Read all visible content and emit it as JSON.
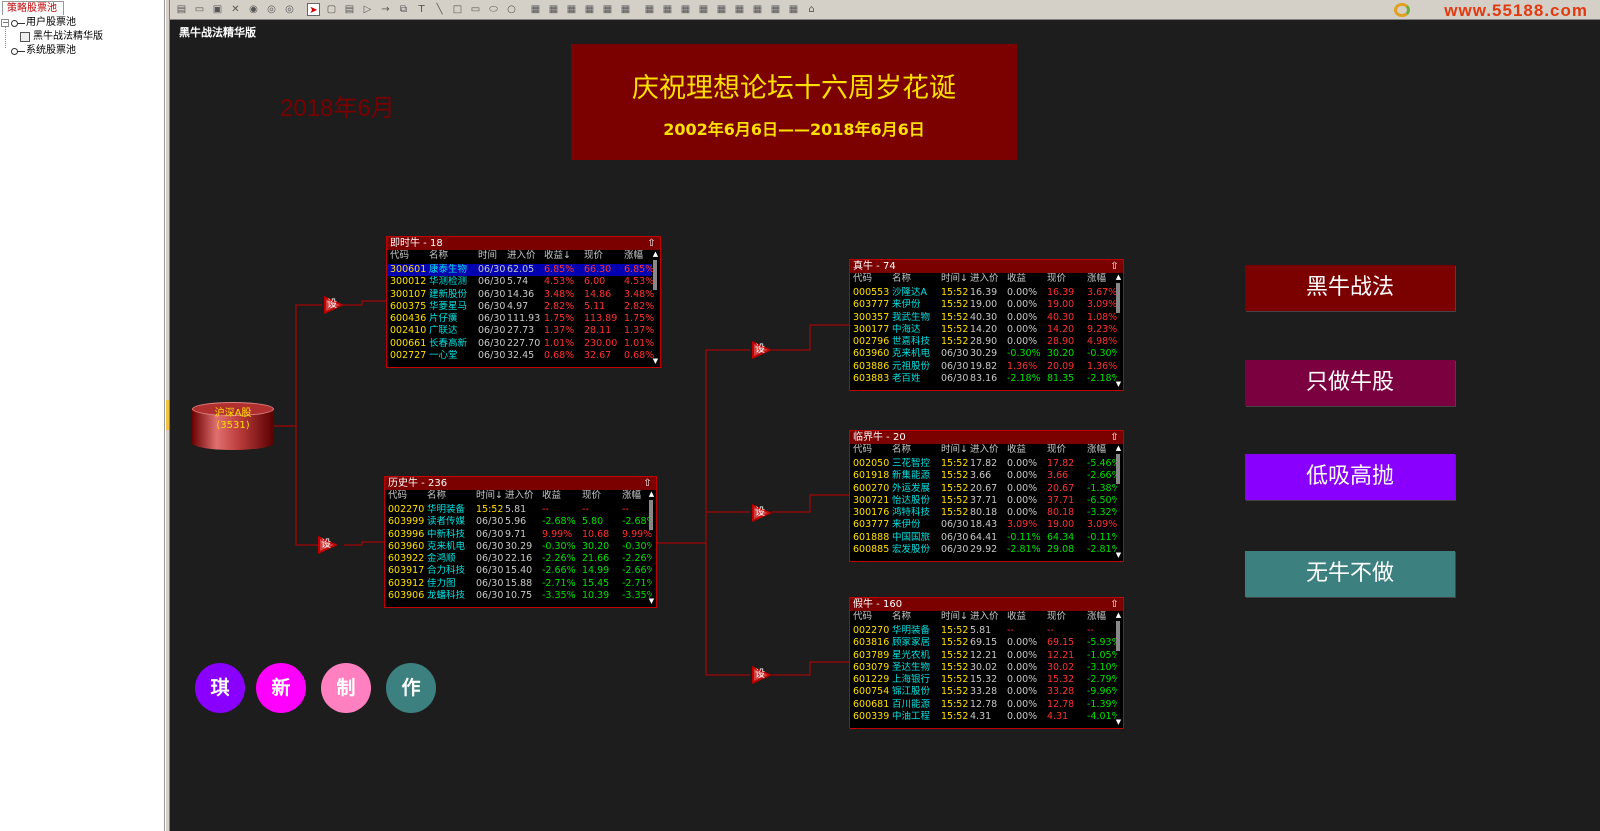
{
  "left_panel": {
    "tab": "策略股票池",
    "tree": [
      {
        "label": "用户股票池",
        "expander": "−"
      },
      {
        "label": "黑牛战法精华版"
      },
      {
        "label": "系统股票池"
      }
    ]
  },
  "toolbar": {
    "buttons": [
      "new-icon",
      "open-icon",
      "save-icon",
      "close-icon",
      "run-icon",
      "pause-icon",
      "stop-icon",
      "select-icon",
      "rect-icon",
      "list-icon",
      "arrow-icon",
      "arrow2-icon",
      "copy-icon",
      "text-icon",
      "line-icon",
      "square-icon",
      "rounded-rect-icon",
      "ellipse-icon",
      "circle-icon",
      "align-left-icon",
      "align-center-icon",
      "align-right-icon",
      "align-top-icon",
      "align-middle-icon",
      "align-bottom-icon",
      "grid1-icon",
      "grid2-icon",
      "grid3-icon",
      "grid4-icon",
      "grid5-icon",
      "grid6-icon",
      "grid7-icon",
      "grid8-icon",
      "grid9-icon",
      "build-icon"
    ],
    "watermark": "www.55188.com"
  },
  "canvas": {
    "title": "黑牛战法精华版",
    "date_label": "2018年6月",
    "banner": {
      "title": "庆祝理想论坛十六周岁花诞",
      "subtitle": "2002年6月6日——2018年6月6日"
    },
    "source": {
      "line1": "沪深A股",
      "line2": "(3531)"
    },
    "setting_label": "设",
    "slogans": [
      {
        "text": "黑牛战法",
        "color": "#7b0000"
      },
      {
        "text": "只做牛股",
        "color": "#7b0040"
      },
      {
        "text": "低吸高抛",
        "color": "#8a00ff"
      },
      {
        "text": "无牛不做",
        "color": "#3c8080"
      }
    ],
    "circles": [
      {
        "text": "琪",
        "color": "#8a00ff"
      },
      {
        "text": "新",
        "color": "#ff00ff"
      },
      {
        "text": "制",
        "color": "#ff80c0"
      },
      {
        "text": "作",
        "color": "#3c8080"
      }
    ]
  },
  "panels": {
    "jishiniu": {
      "title": "即时牛 - 18",
      "headers": [
        "代码",
        "名称",
        "时间",
        "进入价",
        "收益↓",
        "现价",
        "涨幅"
      ],
      "rows": [
        [
          "300601",
          "康泰生物",
          "06/30",
          "62.05",
          "6.85%",
          "66.30",
          "6.85%"
        ],
        [
          "300012",
          "华测检测",
          "06/30",
          "5.74",
          "4.53%",
          "6.00",
          "4.53%"
        ],
        [
          "300107",
          "建新股份",
          "06/30",
          "14.36",
          "3.48%",
          "14.86",
          "3.48%"
        ],
        [
          "600375",
          "华菱星马",
          "06/30",
          "4.97",
          "2.82%",
          "5.11",
          "2.82%"
        ],
        [
          "600436",
          "片仔癀",
          "06/30",
          "111.93",
          "1.75%",
          "113.89",
          "1.75%"
        ],
        [
          "002410",
          "广联达",
          "06/30",
          "27.73",
          "1.37%",
          "28.11",
          "1.37%"
        ],
        [
          "000661",
          "长春高新",
          "06/30",
          "227.70",
          "1.01%",
          "230.00",
          "1.01%"
        ],
        [
          "002727",
          "一心堂",
          "06/30",
          "32.45",
          "0.68%",
          "32.67",
          "0.68%"
        ]
      ]
    },
    "lishiniu": {
      "title": "历史牛 - 236",
      "headers": [
        "代码",
        "名称",
        "时间↓",
        "进入价",
        "收益",
        "现价",
        "涨幅"
      ],
      "rows": [
        [
          "002270",
          "华明装备",
          "15:52",
          "5.81",
          "--",
          "--",
          "--"
        ],
        [
          "603999",
          "读者传媒",
          "06/30",
          "5.96",
          "-2.68%",
          "5.80",
          "-2.68%"
        ],
        [
          "603996",
          "中新科技",
          "06/30",
          "9.71",
          "9.99%",
          "10.68",
          "9.99%"
        ],
        [
          "603960",
          "克来机电",
          "06/30",
          "30.29",
          "-0.30%",
          "30.20",
          "-0.30%"
        ],
        [
          "603922",
          "金鸿顺",
          "06/30",
          "22.16",
          "-2.26%",
          "21.66",
          "-2.26%"
        ],
        [
          "603917",
          "合力科技",
          "06/30",
          "15.40",
          "-2.66%",
          "14.99",
          "-2.66%"
        ],
        [
          "603912",
          "佳力图",
          "06/30",
          "15.88",
          "-2.71%",
          "15.45",
          "-2.71%"
        ],
        [
          "603906",
          "龙蟠科技",
          "06/30",
          "10.75",
          "-3.35%",
          "10.39",
          "-3.35%"
        ]
      ]
    },
    "zhenniu": {
      "title": "真牛 - 74",
      "headers": [
        "代码",
        "名称",
        "时间↓",
        "进入价",
        "收益",
        "现价",
        "涨幅"
      ],
      "rows": [
        [
          "000553",
          "沙隆达A",
          "15:52",
          "16.39",
          "0.00%",
          "16.39",
          "3.67%"
        ],
        [
          "603777",
          "来伊份",
          "15:52",
          "19.00",
          "0.00%",
          "19.00",
          "3.09%"
        ],
        [
          "300357",
          "我武生物",
          "15:52",
          "40.30",
          "0.00%",
          "40.30",
          "1.08%"
        ],
        [
          "300177",
          "中海达",
          "15:52",
          "14.20",
          "0.00%",
          "14.20",
          "9.23%"
        ],
        [
          "002796",
          "世嘉科技",
          "15:52",
          "28.90",
          "0.00%",
          "28.90",
          "4.98%"
        ],
        [
          "603960",
          "克来机电",
          "06/30",
          "30.29",
          "-0.30%",
          "30.20",
          "-0.30%"
        ],
        [
          "603886",
          "元祖股份",
          "06/30",
          "19.82",
          "1.36%",
          "20.09",
          "1.36%"
        ],
        [
          "603883",
          "老百姓",
          "06/30",
          "83.16",
          "-2.18%",
          "81.35",
          "-2.18%"
        ]
      ]
    },
    "linjieniu": {
      "title": "临界牛 - 20",
      "headers": [
        "代码",
        "名称",
        "时间↓",
        "进入价",
        "收益",
        "现价",
        "涨幅"
      ],
      "rows": [
        [
          "002050",
          "三花智控",
          "15:52",
          "17.82",
          "0.00%",
          "17.82",
          "-5.46%"
        ],
        [
          "601918",
          "新集能源",
          "15:52",
          "3.66",
          "0.00%",
          "3.66",
          "-2.66%"
        ],
        [
          "600270",
          "外运发展",
          "15:52",
          "20.67",
          "0.00%",
          "20.67",
          "-1.38%"
        ],
        [
          "300721",
          "怡达股份",
          "15:52",
          "37.71",
          "0.00%",
          "37.71",
          "-6.50%"
        ],
        [
          "300176",
          "鸿特科技",
          "15:52",
          "80.18",
          "0.00%",
          "80.18",
          "-3.32%"
        ],
        [
          "603777",
          "来伊份",
          "06/30",
          "18.43",
          "3.09%",
          "19.00",
          "3.09%"
        ],
        [
          "601888",
          "中国国旅",
          "06/30",
          "64.41",
          "-0.11%",
          "64.34",
          "-0.11%"
        ],
        [
          "600885",
          "宏发股份",
          "06/30",
          "29.92",
          "-2.81%",
          "29.08",
          "-2.81%"
        ]
      ]
    },
    "jianiu": {
      "title": "假牛 - 160",
      "headers": [
        "代码",
        "名称",
        "时间↓",
        "进入价",
        "收益",
        "现价",
        "涨幅"
      ],
      "rows": [
        [
          "002270",
          "华明装备",
          "15:52",
          "5.81",
          "--",
          "--",
          "--"
        ],
        [
          "603816",
          "顾家家居",
          "15:52",
          "69.15",
          "0.00%",
          "69.15",
          "-5.93%"
        ],
        [
          "603789",
          "星光农机",
          "15:52",
          "12.21",
          "0.00%",
          "12.21",
          "-1.05%"
        ],
        [
          "603079",
          "圣达生物",
          "15:52",
          "30.02",
          "0.00%",
          "30.02",
          "-3.10%"
        ],
        [
          "601229",
          "上海银行",
          "15:52",
          "15.32",
          "0.00%",
          "15.32",
          "-2.79%"
        ],
        [
          "600754",
          "锦江股份",
          "15:52",
          "33.28",
          "0.00%",
          "33.28",
          "-9.96%"
        ],
        [
          "600681",
          "百川能源",
          "15:52",
          "12.78",
          "0.00%",
          "12.78",
          "-1.39%"
        ],
        [
          "600339",
          "中油工程",
          "15:52",
          "4.31",
          "0.00%",
          "4.31",
          "-4.01%"
        ]
      ]
    }
  },
  "colors": {
    "up": "#ff3030",
    "down": "#00e000",
    "accent": "#c00000"
  }
}
